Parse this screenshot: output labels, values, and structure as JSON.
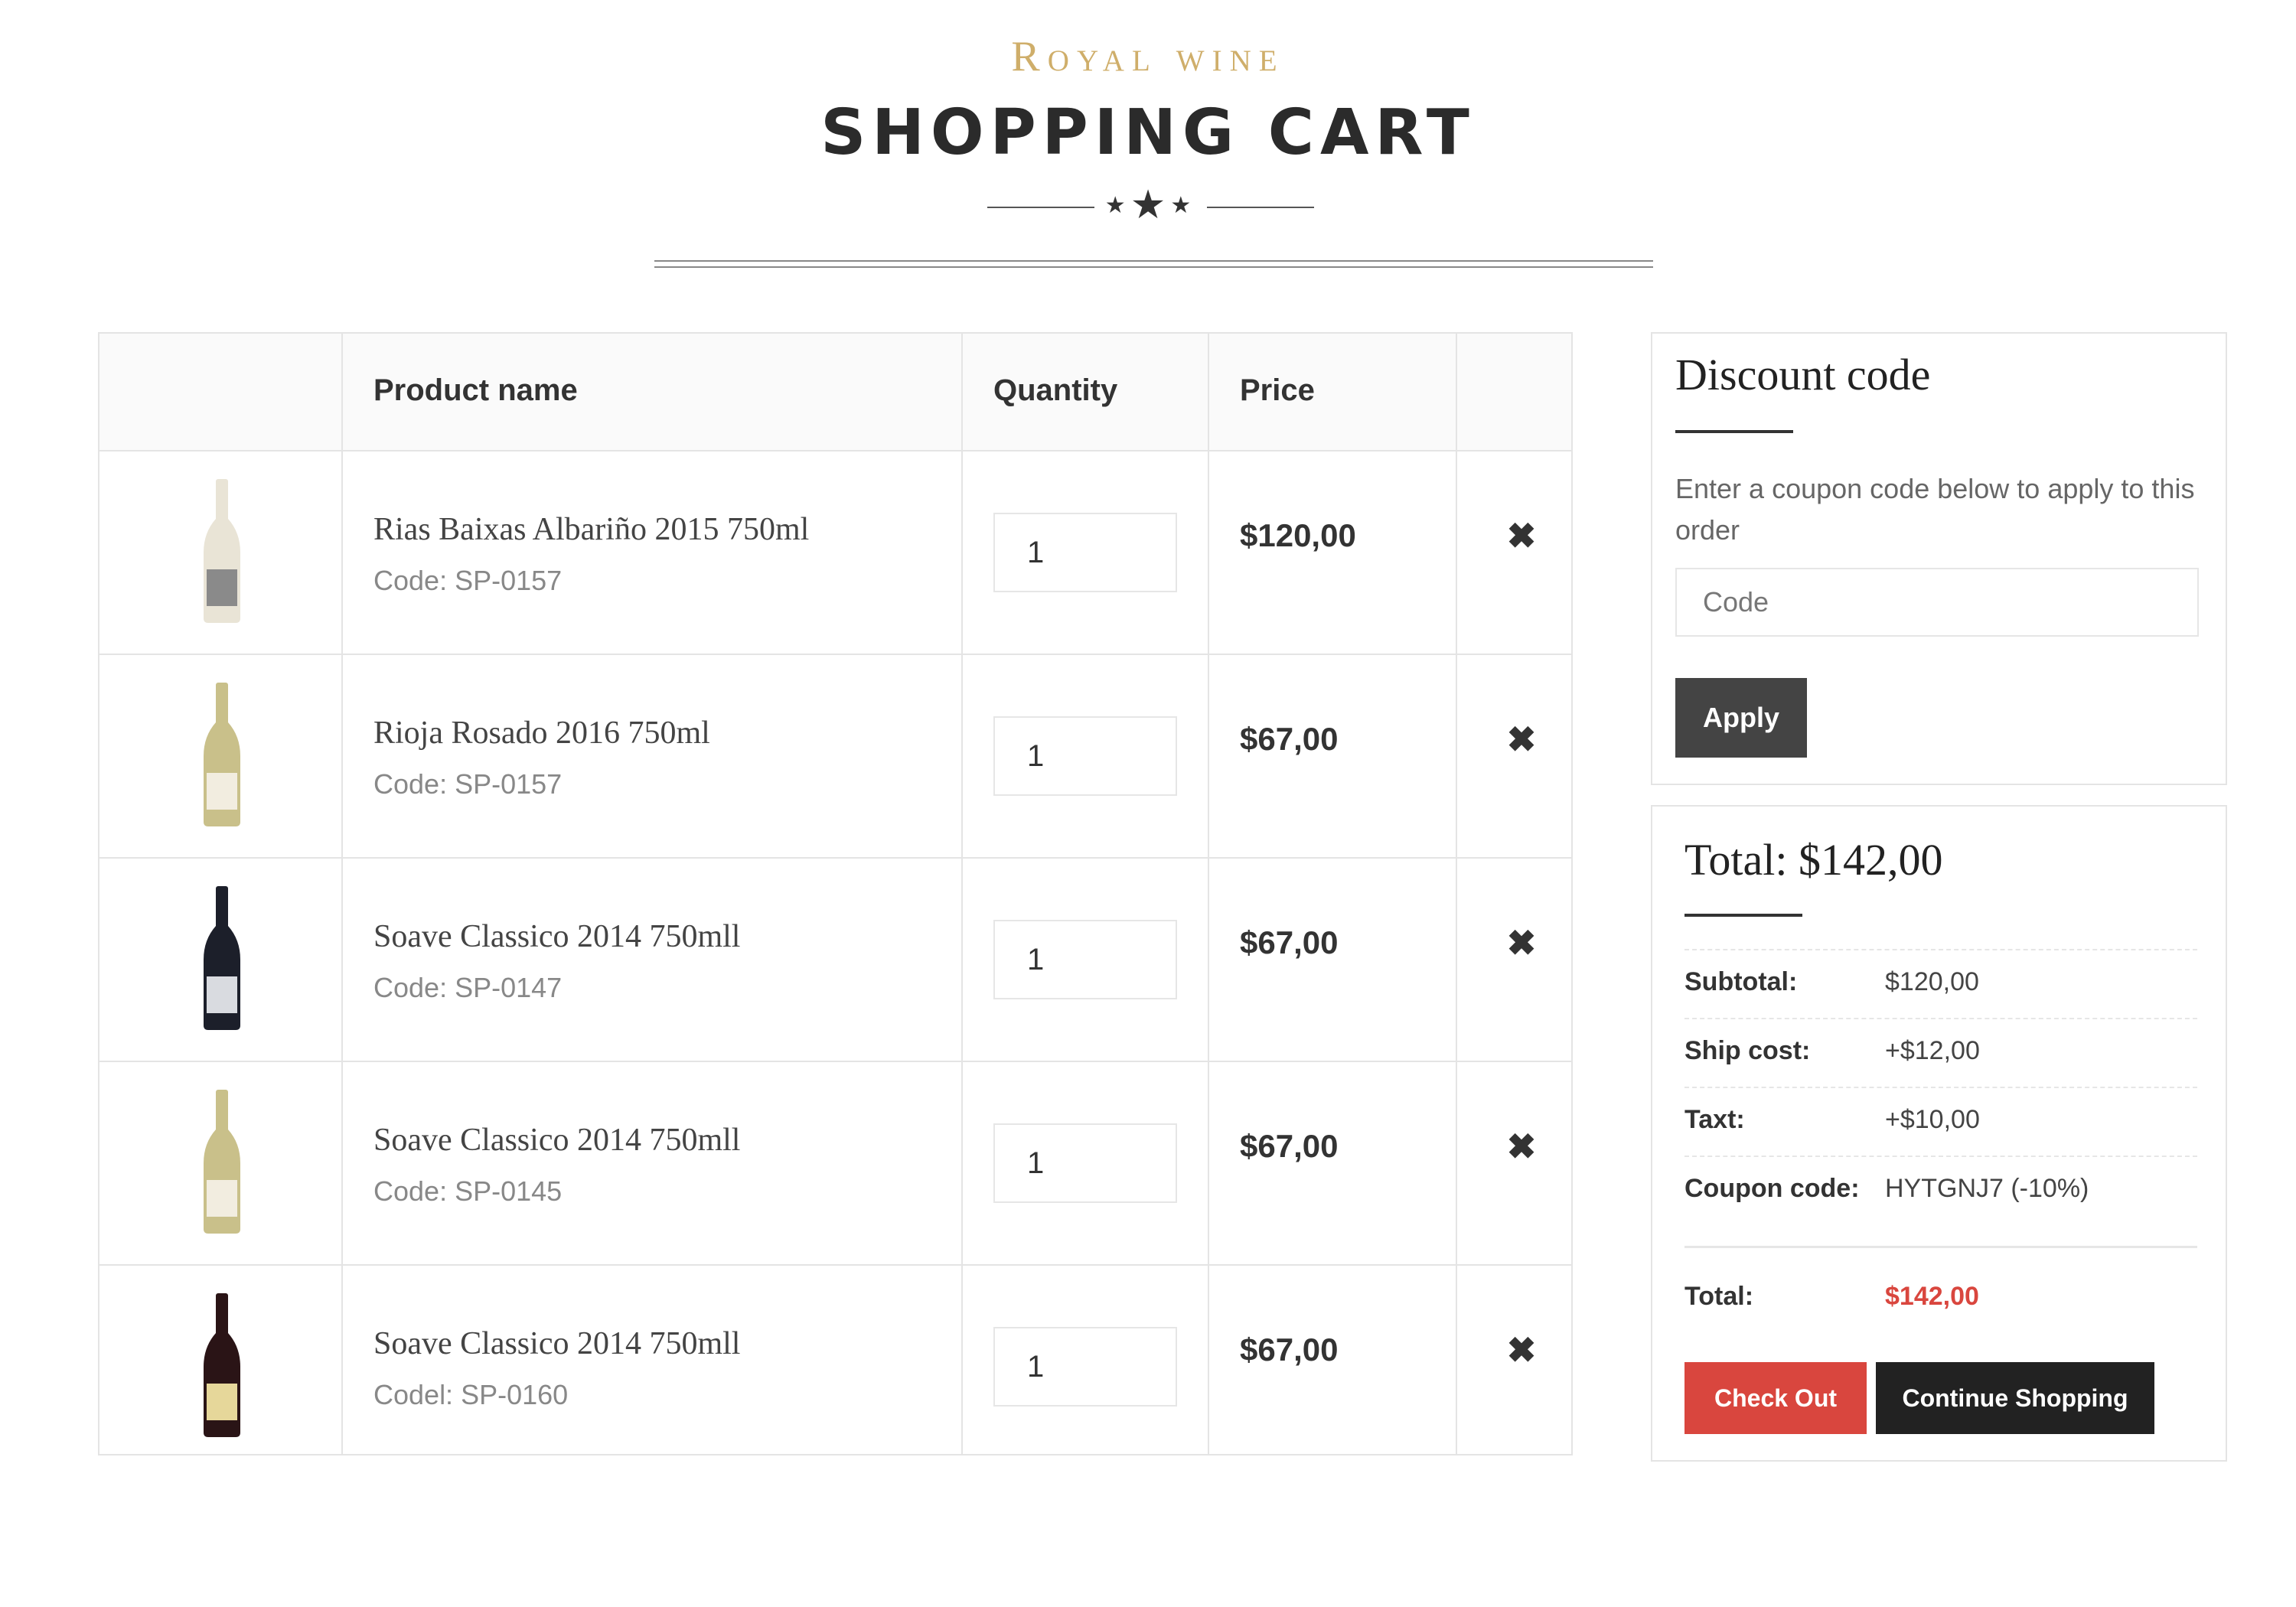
{
  "header": {
    "brand": "Royal wine",
    "title": "SHOPPING CART"
  },
  "cart": {
    "columns": {
      "product": "Product name",
      "quantity": "Quantity",
      "price": "Price"
    },
    "items": [
      {
        "name": "Rias Baixas Albariño 2015 750ml",
        "code": "Code: SP-0157",
        "quantity": "1",
        "price": "$120,00",
        "bottle_color": "#e9e4d6",
        "label_color": "#8a8a8a"
      },
      {
        "name": "Rioja Rosado 2016 750ml",
        "code": "Code: SP-0157",
        "quantity": "1",
        "price": "$67,00",
        "bottle_color": "#c9c08a",
        "label_color": "#f2ede0"
      },
      {
        "name": "Soave Classico 2014 750mll",
        "code": "Code: SP-0147",
        "quantity": "1",
        "price": "$67,00",
        "bottle_color": "#1c1f2a",
        "label_color": "#d9dbe0"
      },
      {
        "name": "Soave Classico 2014 750mll",
        "code": "Code: SP-0145",
        "quantity": "1",
        "price": "$67,00",
        "bottle_color": "#c9c08a",
        "label_color": "#f2ede0"
      },
      {
        "name": "Soave Classico 2014 750mll",
        "code": "Codel: SP-0160",
        "quantity": "1",
        "price": "$67,00",
        "bottle_color": "#2a1416",
        "label_color": "#e6d79a"
      }
    ],
    "remove_icon": "close-icon"
  },
  "discount": {
    "title": "Discount code",
    "note": "Enter a coupon code below to apply to this order",
    "placeholder": "Code",
    "apply_label": "Apply"
  },
  "totals": {
    "title": "Total: $142,00",
    "subtotal_label": "Subtotal:",
    "subtotal_value": "$120,00",
    "ship_label": "Ship cost:",
    "ship_value": "+$12,00",
    "tax_label": "Taxt:",
    "tax_value": "+$10,00",
    "coupon_label": "Coupon code:",
    "coupon_value": "HYTGNJ7 (-10%)",
    "total_label": "Total:",
    "total_value": "$142,00",
    "checkout_label": "Check Out",
    "continue_label": "Continue Shopping"
  },
  "colors": {
    "brand": "#cfae6a",
    "accent_red": "#d9463e",
    "dark": "#222222"
  }
}
